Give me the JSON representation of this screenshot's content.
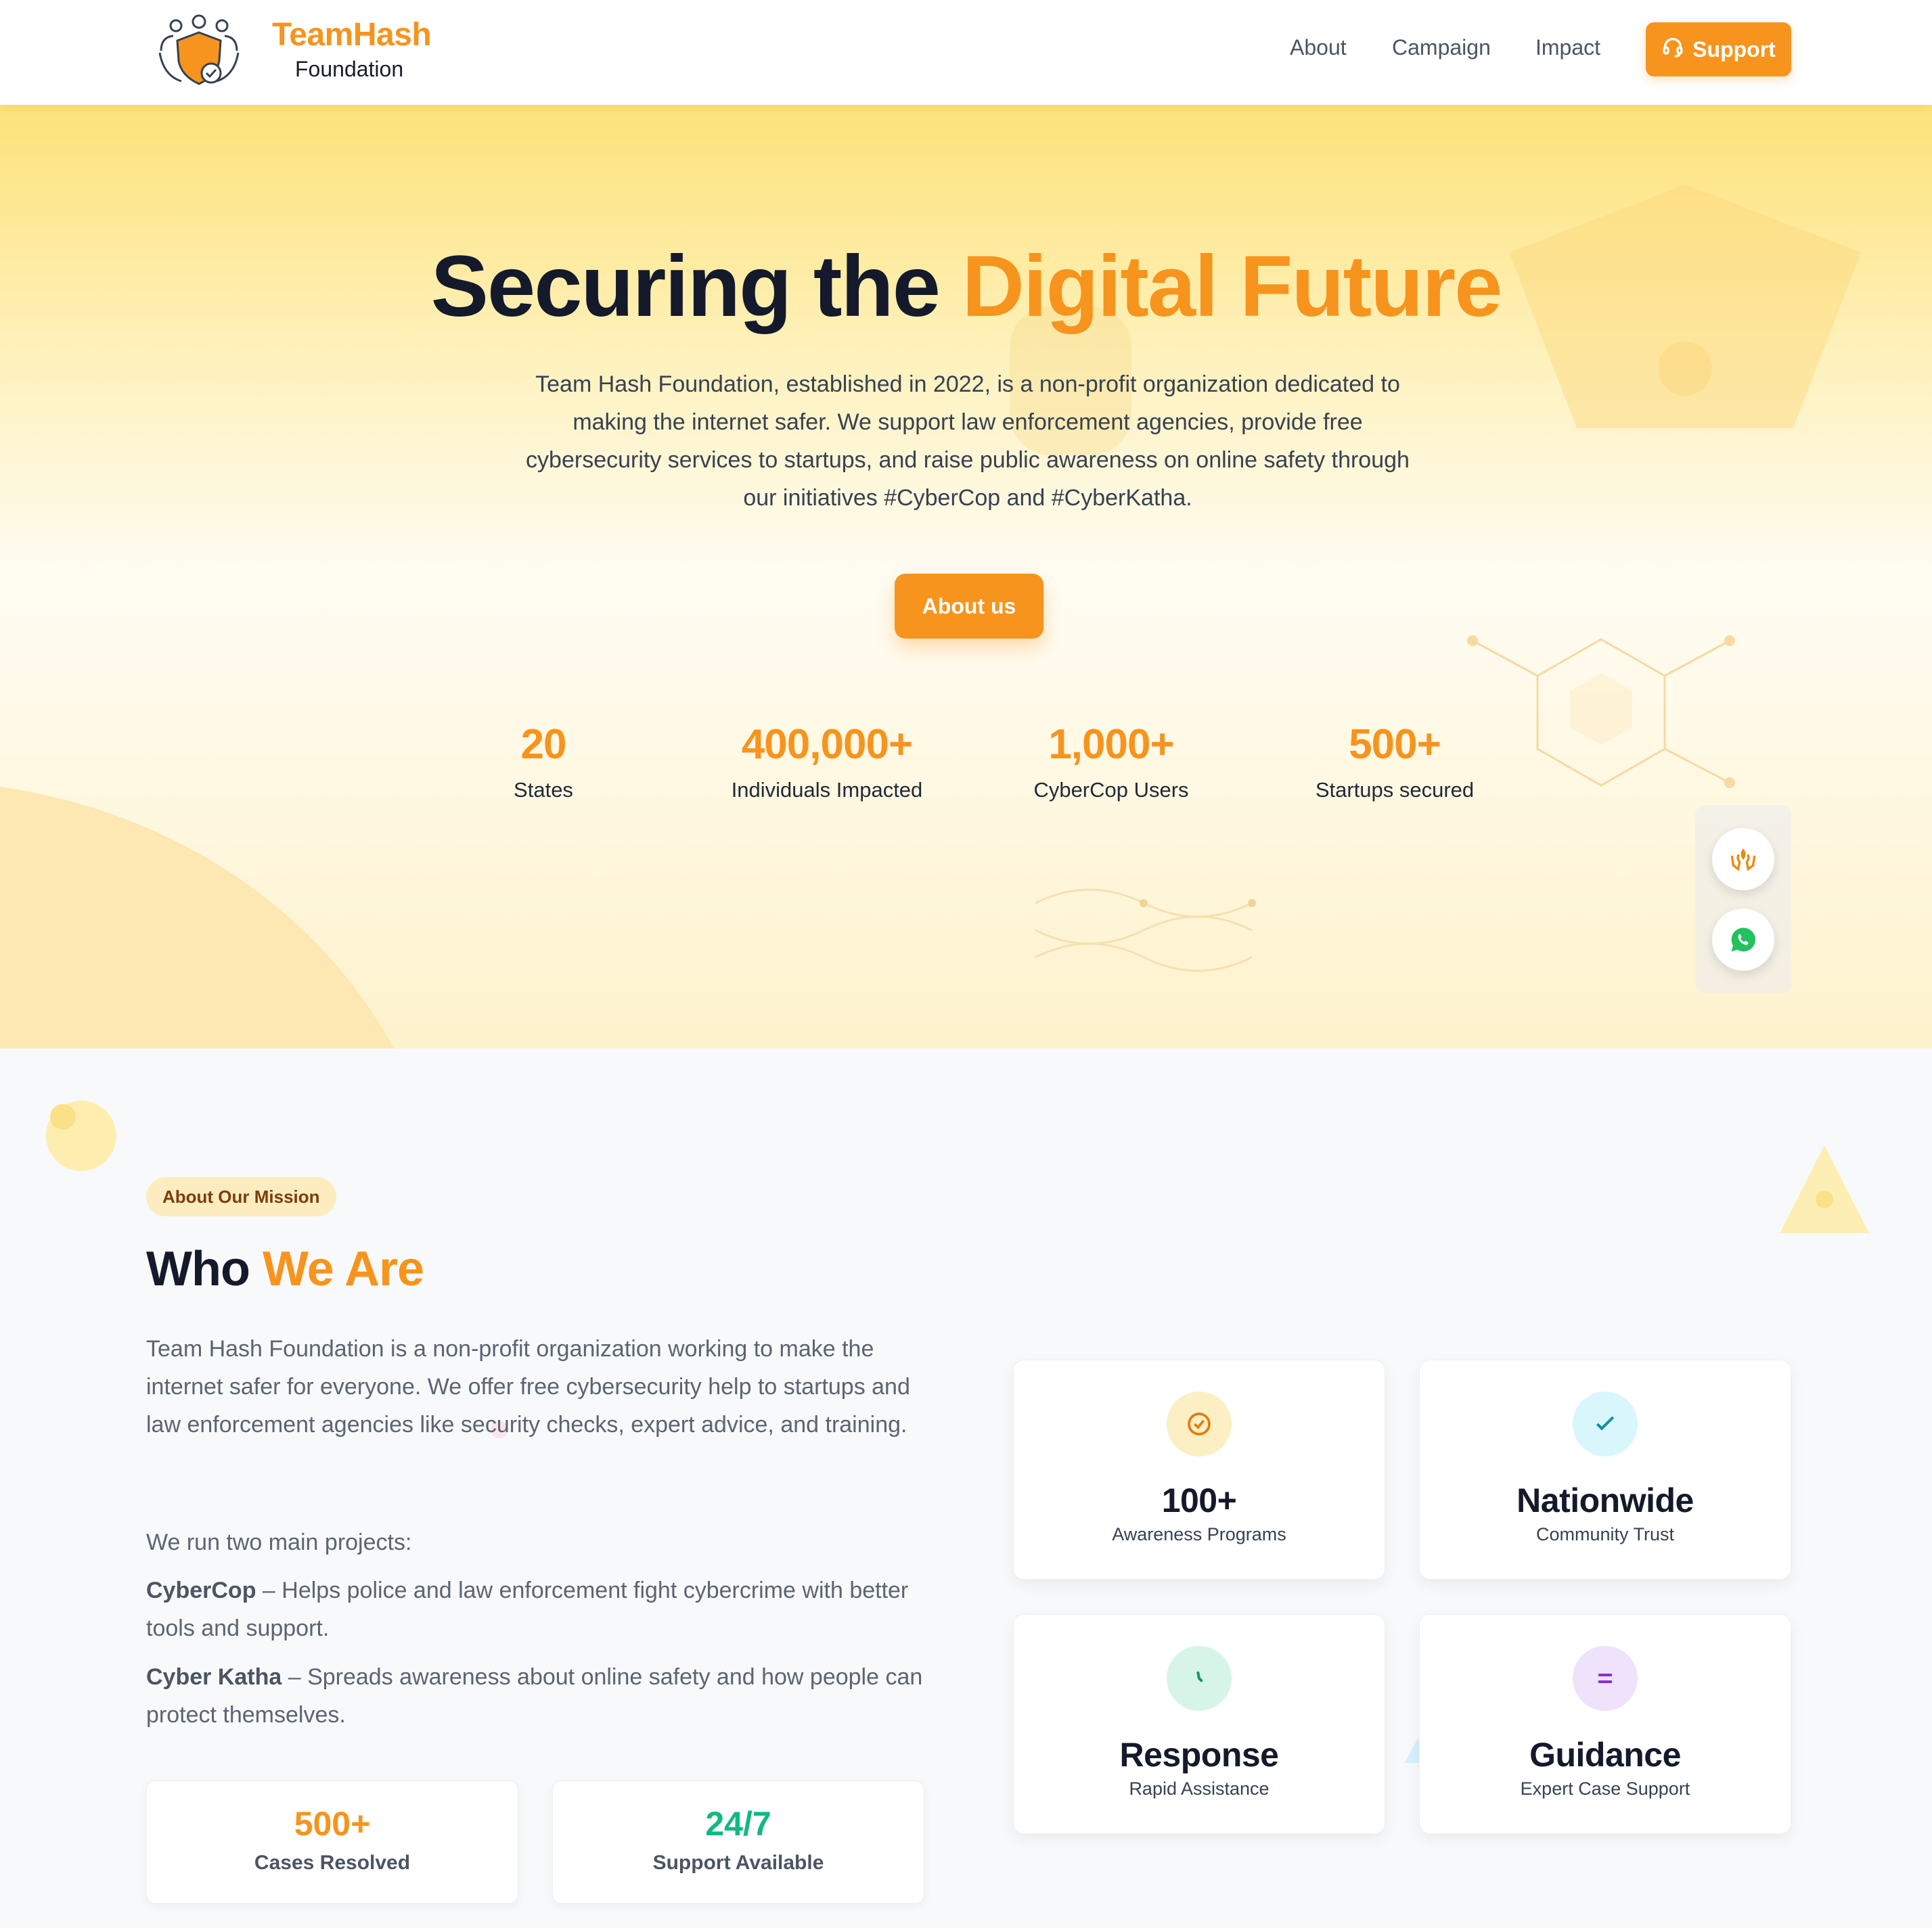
{
  "brand": {
    "name": "TeamHash",
    "sub": "Foundation"
  },
  "nav": {
    "links": [
      "About",
      "Campaign",
      "Impact"
    ],
    "support_label": "Support"
  },
  "hero": {
    "title_main": "Securing the",
    "title_accent": "Digital Future",
    "description": "Team Hash Foundation, established in 2022, is a non-profit organization dedicated to making the internet safer. We support law enforcement agencies, provide free cybersecurity services to startups, and raise public awareness on online safety through our initiatives #CyberCop and #CyberKatha.",
    "cta_label": "About us",
    "stats": [
      {
        "value": "20",
        "label": "States"
      },
      {
        "value": "400,000+",
        "label": "Individuals Impacted"
      },
      {
        "value": "1,000+",
        "label": "CyberCop Users"
      },
      {
        "value": "500+",
        "label": "Startups secured"
      }
    ]
  },
  "floating": {
    "icons": [
      "hands-care-icon",
      "whatsapp-icon"
    ]
  },
  "about": {
    "pill": "About Our Mission",
    "title_main": "Who",
    "title_accent": "We Are",
    "intro": "Team Hash Foundation is a non-profit organization working to make the internet safer for everyone. We offer free cybersecurity help to startups and law enforcement agencies like security checks, expert advice, and training.",
    "projects_intro": "We run two main projects:",
    "projects": [
      {
        "name": "CyberCop",
        "desc": " – Helps police and law enforcement fight cybercrime with better tools and support."
      },
      {
        "name": "Cyber Katha",
        "desc": " – Spreads awareness about online safety and how people can protect themselves."
      }
    ],
    "mini_stats": [
      {
        "value": "500+",
        "label": "Cases Resolved",
        "color": "#f7941d"
      },
      {
        "value": "24/7",
        "label": "Support Available",
        "color": "#10b981"
      }
    ],
    "features": [
      {
        "value": "100+",
        "label": "Awareness Programs",
        "icon": "check-circle-icon",
        "bg": "#fdefc4",
        "fg": "#e57a0f"
      },
      {
        "value": "Nationwide",
        "label": "Community Trust",
        "icon": "check-icon",
        "bg": "#d8f6fb",
        "fg": "#0e8fa6"
      },
      {
        "value": "Response",
        "label": "Rapid Assistance",
        "icon": "clock-icon",
        "bg": "#d7f5e6",
        "fg": "#0f9d58"
      },
      {
        "value": "Guidance",
        "label": "Expert Case Support",
        "icon": "menu-lines-icon",
        "bg": "#efe2fb",
        "fg": "#8b2fc9"
      }
    ]
  },
  "colors": {
    "accent": "#f7941d",
    "dark": "#141a2b",
    "green": "#10b981"
  }
}
